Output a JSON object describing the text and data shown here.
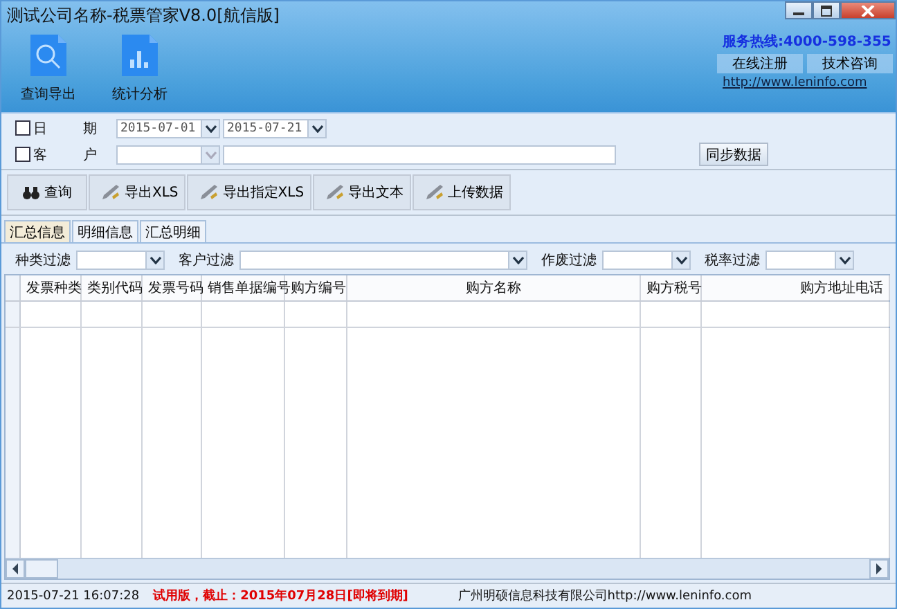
{
  "window": {
    "title": "测试公司名称-税票管家V8.0[航信版]"
  },
  "big_tools": [
    {
      "label": "查询导出",
      "kind": "search"
    },
    {
      "label": "统计分析",
      "kind": "chart"
    }
  ],
  "hotline": "服务热线:4000-598-355",
  "header_buttons": [
    "在线注册",
    "技术咨询"
  ],
  "header_link": "http://www.leninfo.com",
  "date_filter": {
    "label": "日 期",
    "checked": false,
    "from": "2015-07-01",
    "to": "2015-07-21"
  },
  "customer_filter": {
    "label": "客 户",
    "checked": false,
    "dropdown_disabled": true
  },
  "sync_button": "同步数据",
  "actions": [
    {
      "label": "查询",
      "kind": "binoculars"
    },
    {
      "label": "导出XLS",
      "kind": "pen"
    },
    {
      "label": "导出指定XLS",
      "kind": "pen"
    },
    {
      "label": "导出文本",
      "kind": "pen"
    },
    {
      "label": "上传数据",
      "kind": "pen"
    }
  ],
  "tabs": [
    {
      "label": "汇总信息",
      "selected": true
    },
    {
      "label": "明细信息",
      "selected": false
    },
    {
      "label": "汇总明细",
      "selected": false
    }
  ],
  "filters": [
    {
      "label": "种类过滤",
      "kind": "narrow"
    },
    {
      "label": "客户过滤",
      "kind": "wide"
    },
    {
      "label": "作废过滤",
      "kind": "narrow"
    },
    {
      "label": "税率过滤",
      "kind": "narrow"
    }
  ],
  "table": {
    "columns": [
      "发票种类",
      "类别代码",
      "发票号码",
      "销售单据编号",
      "购方编号",
      "购方名称",
      "购方税号",
      "购方地址电话"
    ]
  },
  "status_bar": {
    "datetime": "2015-07-21 16:07:28",
    "notice": "试用版，截止：2015年07月28日[即将到期]",
    "company": "广州明硕信息科技有限公司",
    "url": "http://www.leninfo.com"
  }
}
